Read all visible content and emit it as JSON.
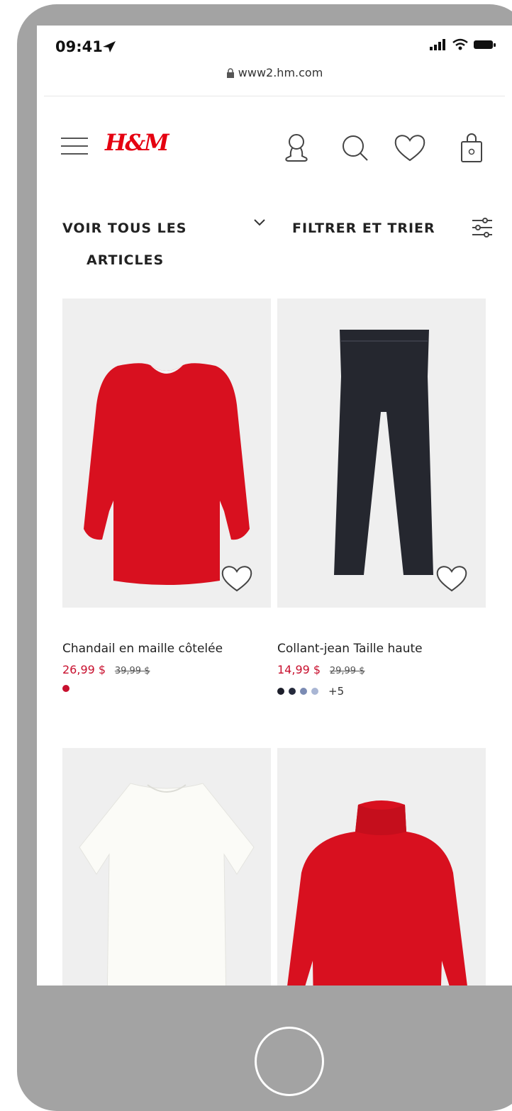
{
  "status": {
    "time": "09:41"
  },
  "browser": {
    "url": "www2.hm.com"
  },
  "header": {
    "logo": "H&M"
  },
  "filters": {
    "voir_line1": "VOIR TOUS LES",
    "voir_line2": "ARTICLES",
    "filtrer": "FILTRER ET TRIER"
  },
  "products": [
    {
      "name": "Chandail en maille côtelée",
      "price": "26,99 $",
      "old_price": "39,99 $",
      "colors": [
        "#c8102e"
      ],
      "more": ""
    },
    {
      "name": "Collant-jean Taille haute",
      "price": "14,99 $",
      "old_price": "29,99 $",
      "colors": [
        "#1c1e2a",
        "#252a3c",
        "#7b8bb3",
        "#a9b6d4"
      ],
      "more": "+5"
    },
    {
      "name": "",
      "price": "",
      "old_price": "",
      "colors": [],
      "more": ""
    },
    {
      "name": "",
      "price": "",
      "old_price": "",
      "colors": [],
      "more": ""
    }
  ],
  "colors": {
    "brand": "#e50010",
    "sale": "#c8102e",
    "frame": "#a3a3a3"
  }
}
